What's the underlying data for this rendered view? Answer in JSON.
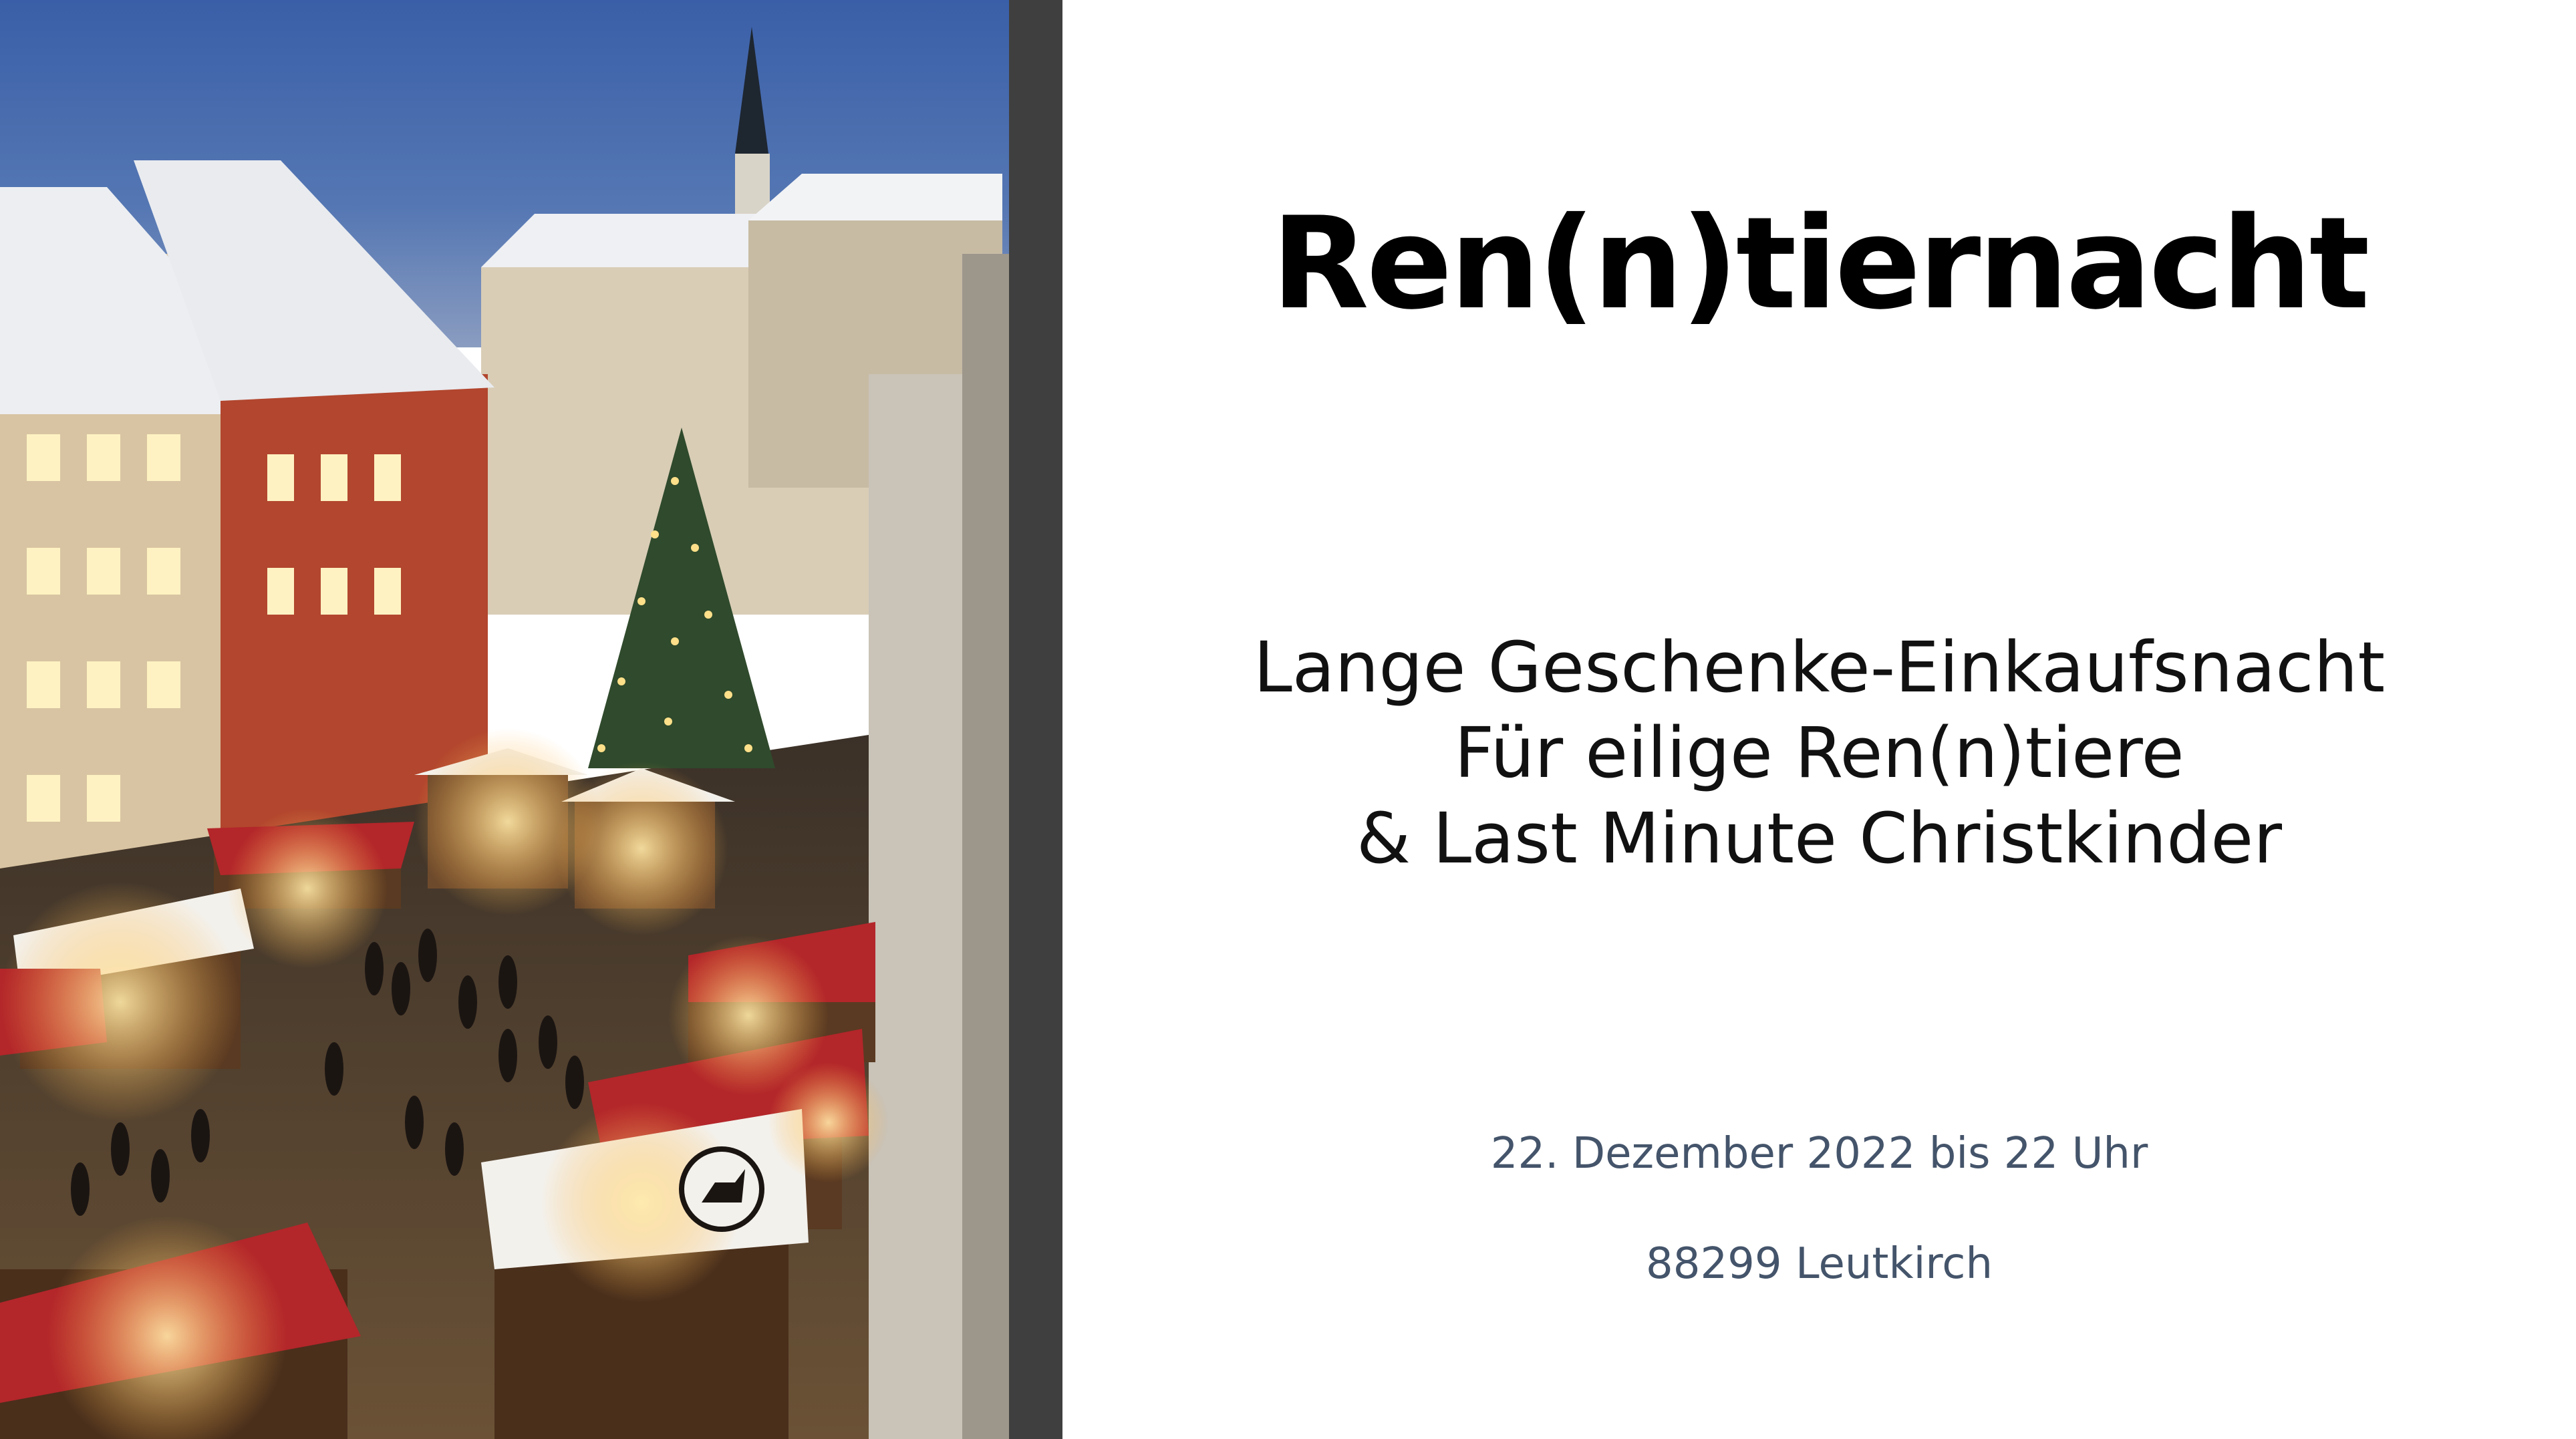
{
  "slide": {
    "title": "Ren(n)tiernacht",
    "subtitle_lines": [
      "Lange Geschenke-Einkaufsnacht",
      "Für eilige Ren(n)tiere",
      "& Last Minute Christkinder"
    ],
    "date": "22. Dezember 2022 bis 22 Uhr",
    "location": "88299 Leutkirch"
  },
  "image": {
    "subject": "christmas-market-photo",
    "sky_color": "#2f4d8a",
    "accent_roof_color": "#b3262a",
    "light_color": "#ffd27a"
  },
  "colors": {
    "title": "#000000",
    "subtitle": "#111111",
    "details": "#44546a",
    "divider": "#3f3f3f",
    "background": "#ffffff"
  }
}
